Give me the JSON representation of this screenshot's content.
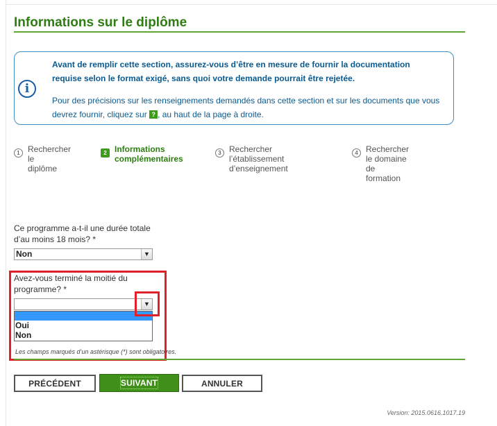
{
  "page_title": "Informations sur le diplôme",
  "notice": {
    "strong": "Avant de remplir cette section, assurez-vous d’être en mesure de fournir la documentation requise selon le format exigé, sans quoi votre demande pourrait être rejetée.",
    "normal_before": "Pour des précisions sur les renseignements demandés dans cette section et sur les documents que vous devrez fournir, cliquez sur ",
    "help_glyph": "?",
    "normal_after": ", au haut de la page à droite."
  },
  "steps": [
    {
      "num": "1",
      "label_line1": "Rechercher le",
      "label_line2": "diplôme"
    },
    {
      "num": "2",
      "label_line1": "Informations",
      "label_line2": "complémentaires"
    },
    {
      "num": "3",
      "label_line1": "Rechercher l’établissement",
      "label_line2": "d’enseignement"
    },
    {
      "num": "4",
      "label_line1": "Rechercher le domaine",
      "label_line2": "de formation"
    }
  ],
  "question1": {
    "label_line1": "Ce programme a-t-il une durée totale",
    "label_line2": "d’au moins 18 mois? *",
    "value": "Non"
  },
  "question2": {
    "label_line1": "Avez-vous terminé la moitié du",
    "label_line2": "programme? *",
    "value": "",
    "options": [
      "Oui",
      "Non"
    ]
  },
  "mandatory_note": "Les champs marqués d’un astérisque (*) sont obligatoires.",
  "buttons": {
    "previous": "PRÉCÉDENT",
    "next": "SUIVANT",
    "cancel": "ANNULER"
  },
  "version": "Version: 2015.0616.1017.19",
  "colors": {
    "accent_green": "#3f8f1a",
    "title_green": "#2e7d12",
    "info_blue": "#0b5a8f",
    "highlight_red": "#e0202a"
  },
  "icons": {
    "info": "info-circle-icon",
    "help": "help-icon",
    "dropdown": "chevron-down-icon"
  }
}
